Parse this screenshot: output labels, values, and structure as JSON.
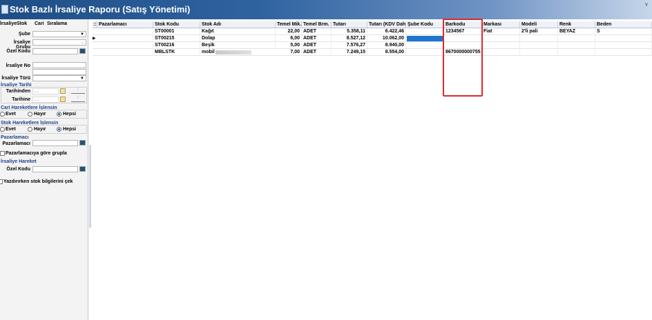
{
  "window": {
    "title": "Stok Bazlı İrsaliye Raporu (Satış Yönetimi)",
    "corner_glyph": "ʏ"
  },
  "filter_tabs": [
    "İrsaliye",
    "Stok",
    "Cari",
    "Sıralama"
  ],
  "filters": {
    "sube_label": "Şube",
    "irsaliye_grubu_label": "İrsaliye Grubu",
    "ozel_kodu_label": "Özel Kodu",
    "irsaliye_no_label": "İrsaliye No",
    "irsaliye_turu_label": "İrsaliye Türü",
    "irsaliye_tarihi_section": "İrsaliye Tarihi",
    "tarihinden_label": "Tarihinden",
    "tarihinden_value": ". .",
    "tarihine_label": "Tarihine",
    "tarihine_value": ". .",
    "time_placeholder": ":",
    "cari_section": "Cari Hareketlere İşlensin",
    "stok_section": "Stok Hareketlere İşlensin",
    "opt_evet": "Evet",
    "opt_hayir": "Hayır",
    "opt_hepsi": "Hepsi",
    "pazarlamaci_section": "Pazarlamacı",
    "pazarlamaci_label": "Pazarlamacı",
    "group_by_label": "Pazarlamacıya göre grupla",
    "irsaliye_hareket_section": "İrsaliye Hareket",
    "hareket_ozel_kodu_label": "Özel Kodu",
    "print_stock_label": "Yazdırırken stok bilgilerini çek",
    "cari_selected": "Hepsi",
    "stok_selected": "Hepsi"
  },
  "grid": {
    "group_glyph": "::",
    "columns": [
      "Pazarlamacı",
      "Stok Kodu",
      "Stok Adı",
      "Temel Mik.",
      "Temel Brm.",
      "Tutarı",
      "Tutarı (KDV Dahil)",
      "Şube Kodu",
      "Barkodu",
      "Markası",
      "Modeli",
      "Renk",
      "Beden"
    ],
    "rows": [
      {
        "pazarlamaci": "",
        "stok_kodu": "ST00001",
        "stok_adi": "Kağıt",
        "temel_mik": "22,00",
        "temel_brm": "ADET",
        "tutari": "5.358,11",
        "tutari_kdv": "6.422,46",
        "sube_kodu": "",
        "barkodu": "1234567",
        "markasi": "Fiat",
        "modeli": "2'li pali",
        "renk": "BEYAZ",
        "beden": "S"
      },
      {
        "pazarlamaci": "",
        "stok_kodu": "ST00215",
        "stok_adi": "Dolap",
        "temel_mik": "6,00",
        "temel_brm": "ADET",
        "tutari": "8.527,12",
        "tutari_kdv": "10.062,00",
        "sube_kodu": "",
        "barkodu": "",
        "markasi": "",
        "modeli": "",
        "renk": "",
        "beden": ""
      },
      {
        "pazarlamaci": "",
        "stok_kodu": "ST00216",
        "stok_adi": "Beşik",
        "temel_mik": "5,00",
        "temel_brm": "ADET",
        "tutari": "7.576,27",
        "tutari_kdv": "8.940,00",
        "sube_kodu": "",
        "barkodu": "",
        "markasi": "",
        "modeli": "",
        "renk": "",
        "beden": ""
      },
      {
        "pazarlamaci": "",
        "stok_kodu": "MBLSTK",
        "stok_adi": "mobil",
        "temel_mik": "7,00",
        "temel_brm": "ADET",
        "tutari": "7.249,15",
        "tutari_kdv": "8.554,00",
        "sube_kodu": "",
        "barkodu": "8670000000755",
        "markasi": "",
        "modeli": "",
        "renk": "",
        "beden": ""
      }
    ],
    "current_row_marker": "▶"
  },
  "colors": {
    "title_bar": "#1f4e86",
    "section_text": "#1b3f8b",
    "highlight_border": "#e0262d",
    "selected_cell": "#1e74d0"
  }
}
